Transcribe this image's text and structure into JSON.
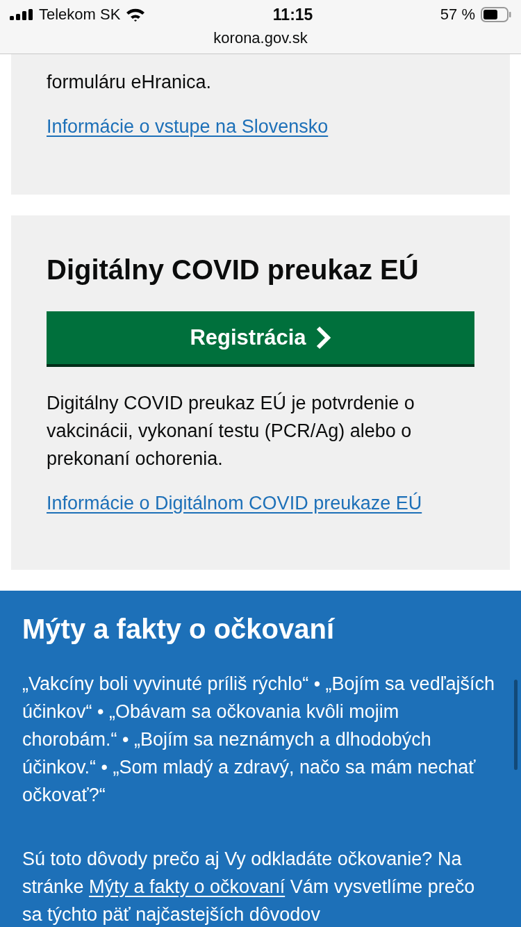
{
  "status_bar": {
    "carrier": "Telekom SK",
    "time": "11:15",
    "battery": "57 %"
  },
  "address_bar": {
    "url": "korona.gov.sk"
  },
  "entry_card": {
    "text": "formuláru eHranica.",
    "link": "Informácie o vstupe na Slovensko"
  },
  "covid_card": {
    "title": "Digitálny COVID preukaz EÚ",
    "button": "Registrácia",
    "text": "Digitálny COVID preukaz EÚ je potvrdenie o vakcinácii, vykonaní testu (PCR/Ag) alebo o prekonaní ochorenia.",
    "link": "Informácie o Digitálnom COVID preukaze EÚ"
  },
  "myths_section": {
    "title": "Mýty a fakty o očkovaní",
    "quotes": "„Vakcíny boli vyvinuté príliš rýchlo“ • „Bojím sa vedľajších účinkov“ • „Obávam sa očkovania kvôli mojim chorobám.“ • „Bojím sa neznámych a dlhodobých účinkov.“ • „Som mladý a zdravý, načo sa mám nechať očkovať?“",
    "text_before": "Sú toto dôvody prečo aj Vy odkladáte očkovanie? Na stránke ",
    "link": "Mýty a fakty o očkovaní",
    "text_after": " Vám vysvetlíme prečo sa týchto päť najčastejších dôvodov"
  }
}
